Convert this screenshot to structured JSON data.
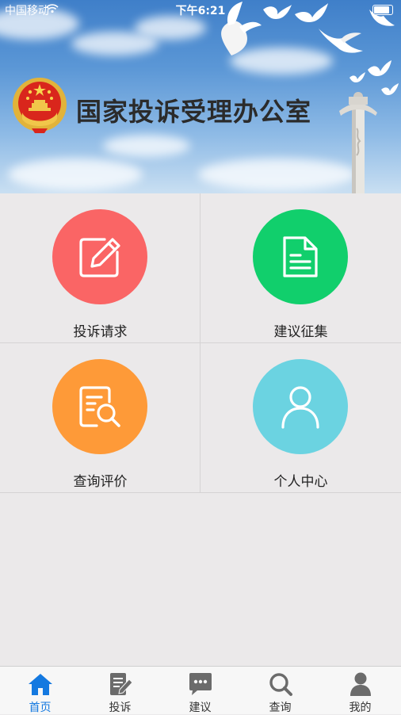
{
  "status_bar": {
    "carrier": "中国移动",
    "time": "下午6:21"
  },
  "banner": {
    "title": "国家投诉受理办公室"
  },
  "menu": [
    {
      "label": "投诉请求",
      "color": "#fa6565",
      "icon": "edit-icon"
    },
    {
      "label": "建议征集",
      "color": "#11cf6c",
      "icon": "document-icon"
    },
    {
      "label": "查询评价",
      "color": "#fe9a38",
      "icon": "search-document-icon"
    },
    {
      "label": "个人中心",
      "color": "#6bd3e1",
      "icon": "user-icon"
    }
  ],
  "tabbar": [
    {
      "label": "首页",
      "icon": "home-icon",
      "active": true
    },
    {
      "label": "投诉",
      "icon": "complaint-icon",
      "active": false
    },
    {
      "label": "建议",
      "icon": "chat-icon",
      "active": false
    },
    {
      "label": "查询",
      "icon": "search-icon",
      "active": false
    },
    {
      "label": "我的",
      "icon": "user-icon",
      "active": false
    }
  ],
  "colors": {
    "active_tab": "#1479e0",
    "inactive_tab": "#6b6b6b",
    "background": "#ebe9ea"
  }
}
